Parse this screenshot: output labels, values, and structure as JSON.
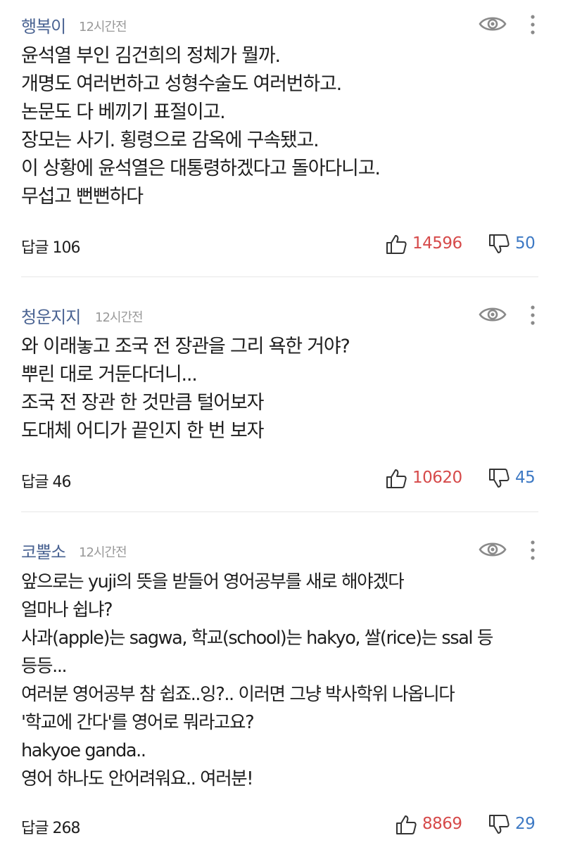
{
  "comments": [
    {
      "nickname": "행복이",
      "time": "12시간전",
      "lines": [
        "윤석열 부인 김건희의 정체가 뭘까.",
        "개명도 여러번하고 성형수술도 여러번하고.",
        "논문도 다 베끼기 표절이고.",
        "장모는 사기. 횡령으로 감옥에 구속됐고.",
        "이 상황에 윤석열은 대통령하겠다고 돌아다니고.",
        "무섭고 뻔뻔하다"
      ],
      "reply_label": "답글 106",
      "likes": "14596",
      "dislikes": "50"
    },
    {
      "nickname": "청운지지",
      "time": "12시간전",
      "lines": [
        "와 이래놓고 조국 전 장관을 그리 욕한 거야?",
        "뿌린 대로 거둔다더니...",
        "조국 전 장관 한 것만큼 털어보자",
        "도대체 어디가 끝인지 한 번 보자"
      ],
      "reply_label": "답글 46",
      "likes": "10620",
      "dislikes": "45"
    },
    {
      "nickname": "코뿔소",
      "time": "12시간전",
      "lines": [
        "앞으로는 yuji의 뜻을 받들어 영어공부를 새로 해야겠다",
        "얼마나 쉽냐?",
        "사과(apple)는 sagwa,  학교(school)는 hakyo, 쌀(rice)는 ssal 등",
        "등등...",
        "여러분 영어공부 참 쉽죠..잉?.. 이러면 그냥 박사학위 나옵니다",
        "'학교에 간다'를 영어로 뭐라고요?",
        "hakyoe ganda..",
        "영어 하나도 안어려워요.. 여러분!"
      ],
      "reply_label": "답글 268",
      "likes": "8869",
      "dislikes": "29"
    }
  ],
  "icons": {
    "view": "eye-icon",
    "more": "more-vertical-icon",
    "like": "thumbs-up-icon",
    "dislike": "thumbs-down-icon"
  },
  "colors": {
    "nickname": "#4a6392",
    "like": "#d64a4a",
    "dislike": "#3d79c4",
    "time": "#999999"
  }
}
